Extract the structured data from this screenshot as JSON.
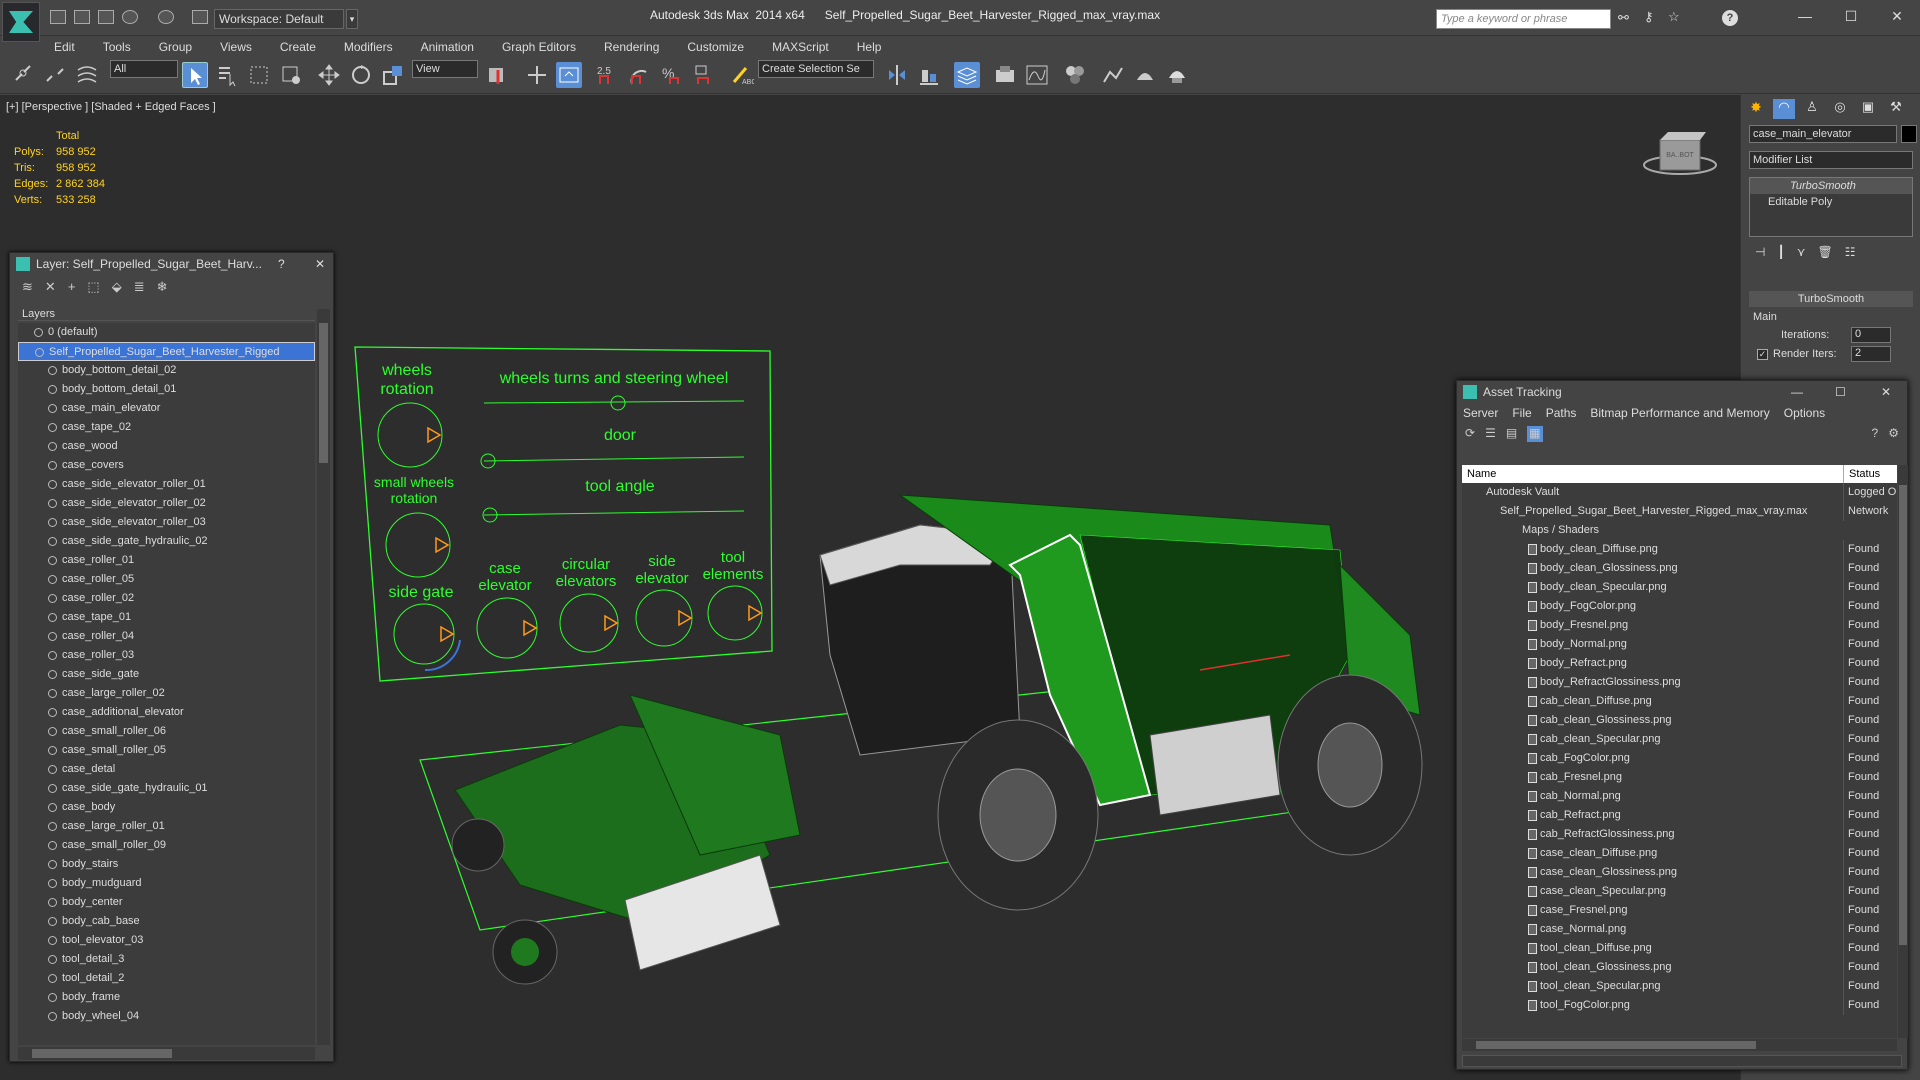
{
  "titlebar": {
    "workspace": "Workspace: Default",
    "app_title": "Autodesk 3ds Max  2014 x64      Self_Propelled_Sugar_Beet_Harvester_Rigged_max_vray.max",
    "search_placeholder": "Type a keyword or phrase"
  },
  "menu": [
    "Edit",
    "Tools",
    "Group",
    "Views",
    "Create",
    "Modifiers",
    "Animation",
    "Graph Editors",
    "Rendering",
    "Customize",
    "MAXScript",
    "Help"
  ],
  "toolbar": {
    "filter_select": "All",
    "refcoord_select": "View",
    "selection_set": "Create Selection Se"
  },
  "viewport": {
    "label": "[+] [Perspective ] [Shaded + Edged Faces ]",
    "stats": {
      "header": "Total",
      "rows": [
        {
          "k": "Polys:",
          "v": "958 952"
        },
        {
          "k": "Tris:",
          "v": "958 952"
        },
        {
          "k": "Edges:",
          "v": "2 862 384"
        },
        {
          "k": "Verts:",
          "v": "533 258"
        }
      ]
    },
    "rig": {
      "wheels_rotation": "wheels rotation",
      "wheels_turns": "wheels turns and steering wheel",
      "door": "door",
      "small_wheels": "small wheels rotation",
      "tool_angle": "tool angle",
      "side_gate": "side gate",
      "case_elevator": "case elevator",
      "circular_elevators": "circular elevators",
      "side_elevator": "side elevator",
      "tool_elements": "tool elements"
    },
    "viewcube_label": "BA..BOT"
  },
  "command_panel": {
    "object_name": "case_main_elevator",
    "modifier_list": "Modifier List",
    "stack": [
      "TurboSmooth",
      "Editable Poly"
    ],
    "rollout_title": "TurboSmooth",
    "group": "Main",
    "iterations_label": "Iterations:",
    "iterations_value": "0",
    "render_iters_label": "Render Iters:",
    "render_iters_value": "2"
  },
  "layer_window": {
    "title": "Layer: Self_Propelled_Sugar_Beet_Harv...",
    "help": "?",
    "column": "Layers",
    "layers": [
      {
        "name": "0 (default)",
        "level": 0
      },
      {
        "name": "Self_Propelled_Sugar_Beet_Harvester_Rigged",
        "level": 0,
        "selected": true
      },
      {
        "name": "body_bottom_detail_02",
        "level": 1
      },
      {
        "name": "body_bottom_detail_01",
        "level": 1
      },
      {
        "name": "case_main_elevator",
        "level": 1
      },
      {
        "name": "case_tape_02",
        "level": 1
      },
      {
        "name": "case_wood",
        "level": 1
      },
      {
        "name": "case_covers",
        "level": 1
      },
      {
        "name": "case_side_elevator_roller_01",
        "level": 1
      },
      {
        "name": "case_side_elevator_roller_02",
        "level": 1
      },
      {
        "name": "case_side_elevator_roller_03",
        "level": 1
      },
      {
        "name": "case_side_gate_hydraulic_02",
        "level": 1
      },
      {
        "name": "case_roller_01",
        "level": 1
      },
      {
        "name": "case_roller_05",
        "level": 1
      },
      {
        "name": "case_roller_02",
        "level": 1
      },
      {
        "name": "case_tape_01",
        "level": 1
      },
      {
        "name": "case_roller_04",
        "level": 1
      },
      {
        "name": "case_roller_03",
        "level": 1
      },
      {
        "name": "case_side_gate",
        "level": 1
      },
      {
        "name": "case_large_roller_02",
        "level": 1
      },
      {
        "name": "case_additional_elevator",
        "level": 1
      },
      {
        "name": "case_small_roller_06",
        "level": 1
      },
      {
        "name": "case_small_roller_05",
        "level": 1
      },
      {
        "name": "case_detal",
        "level": 1
      },
      {
        "name": "case_side_gate_hydraulic_01",
        "level": 1
      },
      {
        "name": "case_body",
        "level": 1
      },
      {
        "name": "case_large_roller_01",
        "level": 1
      },
      {
        "name": "case_small_roller_09",
        "level": 1
      },
      {
        "name": "body_stairs",
        "level": 1
      },
      {
        "name": "body_mudguard",
        "level": 1
      },
      {
        "name": "body_center",
        "level": 1
      },
      {
        "name": "body_cab_base",
        "level": 1
      },
      {
        "name": "tool_elevator_03",
        "level": 1
      },
      {
        "name": "tool_detail_3",
        "level": 1
      },
      {
        "name": "tool_detail_2",
        "level": 1
      },
      {
        "name": "body_frame",
        "level": 1
      },
      {
        "name": "body_wheel_04",
        "level": 1
      }
    ]
  },
  "asset_window": {
    "title": "Asset Tracking",
    "menu": [
      "Server",
      "File",
      "Paths",
      "Bitmap Performance and Memory",
      "Options"
    ],
    "col_name": "Name",
    "col_status": "Status",
    "vault": {
      "name": "Autodesk Vault",
      "status": "Logged O"
    },
    "file": {
      "name": "Self_Propelled_Sugar_Beet_Harvester_Rigged_max_vray.max",
      "status": "Network"
    },
    "group": "Maps / Shaders",
    "maps": [
      {
        "name": "body_clean_Diffuse.png",
        "status": "Found"
      },
      {
        "name": "body_clean_Glossiness.png",
        "status": "Found"
      },
      {
        "name": "body_clean_Specular.png",
        "status": "Found"
      },
      {
        "name": "body_FogColor.png",
        "status": "Found"
      },
      {
        "name": "body_Fresnel.png",
        "status": "Found"
      },
      {
        "name": "body_Normal.png",
        "status": "Found"
      },
      {
        "name": "body_Refract.png",
        "status": "Found"
      },
      {
        "name": "body_RefractGlossiness.png",
        "status": "Found"
      },
      {
        "name": "cab_clean_Diffuse.png",
        "status": "Found"
      },
      {
        "name": "cab_clean_Glossiness.png",
        "status": "Found"
      },
      {
        "name": "cab_clean_Specular.png",
        "status": "Found"
      },
      {
        "name": "cab_FogColor.png",
        "status": "Found"
      },
      {
        "name": "cab_Fresnel.png",
        "status": "Found"
      },
      {
        "name": "cab_Normal.png",
        "status": "Found"
      },
      {
        "name": "cab_Refract.png",
        "status": "Found"
      },
      {
        "name": "cab_RefractGlossiness.png",
        "status": "Found"
      },
      {
        "name": "case_clean_Diffuse.png",
        "status": "Found"
      },
      {
        "name": "case_clean_Glossiness.png",
        "status": "Found"
      },
      {
        "name": "case_clean_Specular.png",
        "status": "Found"
      },
      {
        "name": "case_Fresnel.png",
        "status": "Found"
      },
      {
        "name": "case_Normal.png",
        "status": "Found"
      },
      {
        "name": "tool_clean_Diffuse.png",
        "status": "Found"
      },
      {
        "name": "tool_clean_Glossiness.png",
        "status": "Found"
      },
      {
        "name": "tool_clean_Specular.png",
        "status": "Found"
      },
      {
        "name": "tool_FogColor.png",
        "status": "Found"
      }
    ]
  },
  "colors": {
    "accent": "#2dff2d",
    "selection": "#3c74d6",
    "stats": "#ffd21f",
    "brand": "#3bbfb0"
  }
}
